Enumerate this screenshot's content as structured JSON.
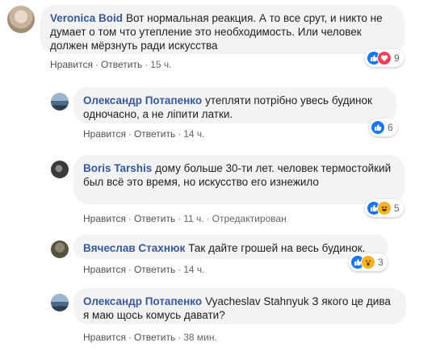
{
  "comments": [
    {
      "author": "Veronica Boid",
      "text": "Вот нормальная реакция. А то все срут, и никто не думает о том что утепление это необходимость. Или человек должен мёрзнуть ради искусства",
      "like": "Нравится",
      "reply": "Ответить",
      "time": "15 ч.",
      "reaction_count": "9",
      "reactions": [
        "like-icon",
        "love-icon"
      ]
    },
    {
      "author": "Олександр Потапенко",
      "text": "утепляти потрібно увесь будинок одночасно, а не ліпити латки.",
      "like": "Нравится",
      "reply": "Ответить",
      "time": "14 ч.",
      "reaction_count": "6",
      "reactions": [
        "like-icon"
      ]
    },
    {
      "author": "Boris Tarshis",
      "text": "дому больше 30-ти лет. человек термостойкий был всё это время, но искусство его изнежило",
      "like": "Нравится",
      "reply": "Ответить",
      "time": "11 ч.",
      "edited": "Отредактирован",
      "reaction_count": "5",
      "reactions": [
        "like-icon",
        "haha-icon"
      ]
    },
    {
      "author": "Вячеслав Стахнюк",
      "text": "Так дайте грошей на весь будинок.",
      "like": "Нравится",
      "reply": "Ответить",
      "time": "14 ч.",
      "reaction_count": "3",
      "reactions": [
        "like-icon",
        "wow-icon"
      ]
    },
    {
      "author": "Олександр Потапенко",
      "text": "Vyacheslav Stahnyuk З якого це дива я маю щось комусь давати?",
      "like": "Нравится",
      "reply": "Ответить",
      "time": "38 мин."
    }
  ],
  "colors": {
    "bubble": "#f2f3f5",
    "author": "#385898",
    "like": "#1877f2",
    "love": "#f33e58",
    "haha": "#f7b125"
  }
}
